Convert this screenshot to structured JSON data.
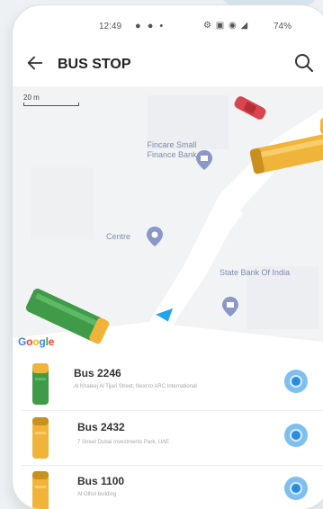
{
  "status_bar": {
    "time": "12:49",
    "icons_left": "● ● •",
    "icons_right": "⚙ ▣ ◉ ◢",
    "battery": "74%"
  },
  "header": {
    "title": "BUS STOP",
    "back_icon": "arrow-left",
    "search_icon": "magnifier"
  },
  "map": {
    "scale_label": "20 m",
    "places": [
      {
        "name": "Fincare Small\nFinance Bank",
        "icon": "bank-pin"
      },
      {
        "name": "Centre",
        "icon": "pin"
      },
      {
        "name": "State Bank Of India",
        "icon": "bank-pin"
      }
    ],
    "attribution": "Google",
    "colors": {
      "road": "#ffffff",
      "land": "#f2f3f5",
      "poi_pin": "#8a97c7",
      "user_arrow": "#1ea6ef"
    }
  },
  "buses": [
    {
      "name": "Bus 2246",
      "address": "Al Khaleej Al Tijari Street, Next to ARC International",
      "color": "#3f9b48"
    },
    {
      "name": "Bus 2432",
      "address": "7 Street Dubai Investments Park, UAE",
      "color": "#f0b43a"
    },
    {
      "name": "Bus 1100",
      "address": "Al Olhol building",
      "color": "#f0b43a"
    }
  ]
}
